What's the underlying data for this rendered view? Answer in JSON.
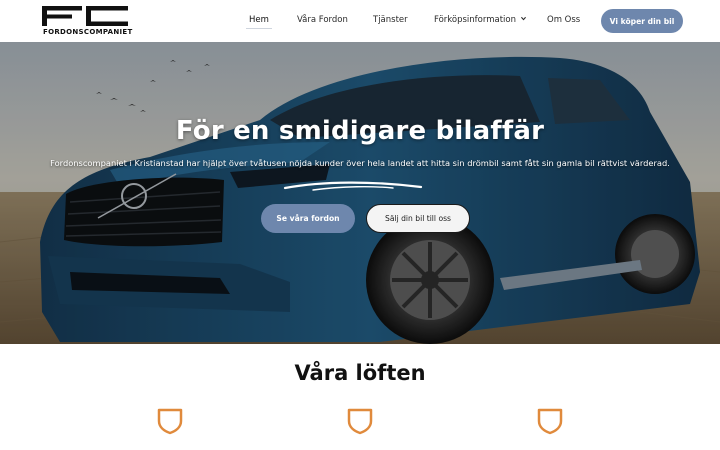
{
  "brand": {
    "logo_text": "FORDONSCOMPANIET",
    "logo_mark": "FC"
  },
  "nav": {
    "items": [
      {
        "label": "Hem",
        "active": true
      },
      {
        "label": "Våra Fordon"
      },
      {
        "label": "Tjänster"
      },
      {
        "label": "Förköpsinformation",
        "has_dropdown": true
      },
      {
        "label": "Om Oss"
      }
    ],
    "cta_label": "Vi köper din bil"
  },
  "hero": {
    "title_prefix": "För en ",
    "title_highlight": "smidigare",
    "title_suffix": " bilaffär",
    "subtitle": "Fordonscompaniet i Kristianstad har hjälpt över tvåtusen nöjda kunder över hela landet att hitta sin drömbil samt fått sin gamla bil rättvist värderad.",
    "primary_button": "Se våra fordon",
    "secondary_button": "Sälj din bil till oss"
  },
  "promises": {
    "title": "Våra löften",
    "items": [
      {
        "icon": "shield-icon"
      },
      {
        "icon": "shield-icon"
      },
      {
        "icon": "shield-icon"
      }
    ]
  },
  "colors": {
    "accent": "#6e87ad",
    "icon_orange": "#e08a3c",
    "text_dark": "#111111"
  }
}
